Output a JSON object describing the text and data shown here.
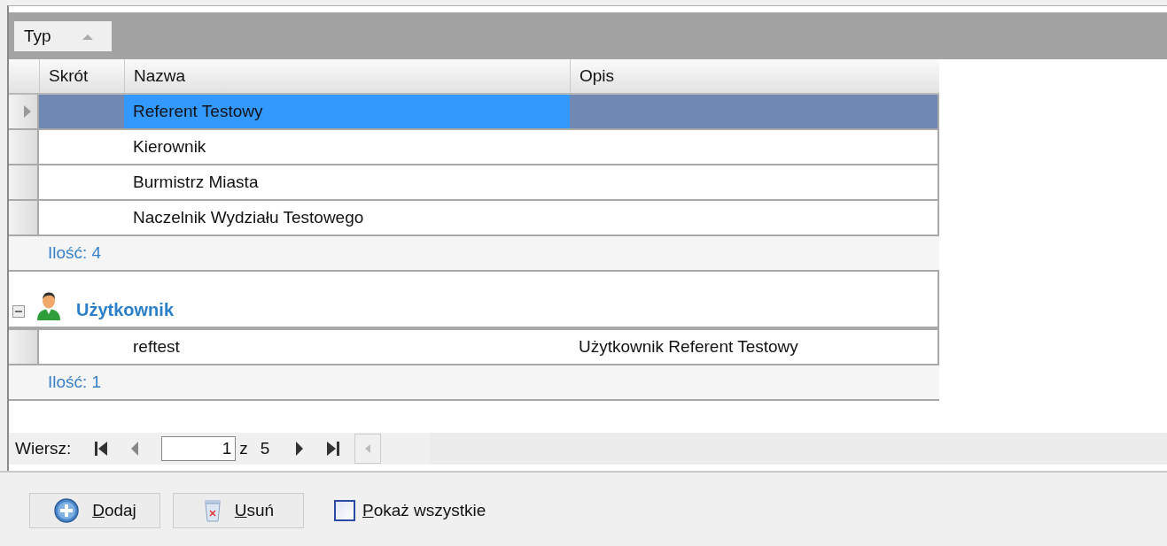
{
  "group_panel": {
    "chips": [
      {
        "label": "Typ",
        "sorted_ascending": true
      }
    ]
  },
  "columns": [
    "Skrót",
    "Nazwa",
    "Opis"
  ],
  "groups": [
    {
      "rows": [
        {
          "name": "Referent Testowy",
          "selected": true
        },
        {
          "name": "Kierownik",
          "selected": false
        },
        {
          "name": "Burmistrz Miasta",
          "selected": false
        },
        {
          "name": "Naczelnik Wydziału Testowego",
          "selected": false
        }
      ],
      "summary": "Ilość: 4"
    },
    {
      "title": "Użytkownik",
      "expanded": true,
      "rows": [
        {
          "name": "reftest",
          "description": "Użytkownik Referent Testowy",
          "selected": false
        }
      ],
      "summary": "Ilość: 1"
    }
  ],
  "navigator": {
    "label": "Wiersz:",
    "current": "1",
    "of": "z",
    "total": "5"
  },
  "buttons": [
    {
      "label": "Dodaj",
      "kind": "add"
    },
    {
      "label": "Usuń",
      "kind": "delete"
    }
  ],
  "show_all": {
    "label": "Pokaż wszystkie",
    "checked": false
  }
}
